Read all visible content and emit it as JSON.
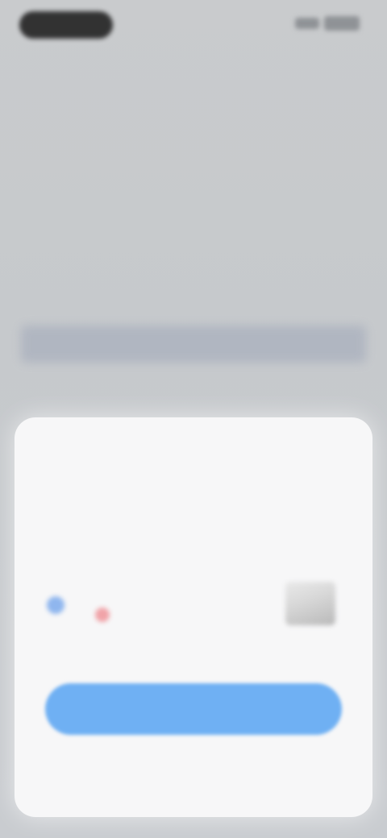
{
  "status_bar": {
    "time": "",
    "indicators": [
      "signal-icon",
      "battery-icon"
    ]
  },
  "sheet": {
    "title": "",
    "description": "",
    "option": {
      "label": "",
      "radio": "radio-icon",
      "badge": "badge-icon"
    },
    "confirm_label": "",
    "footer_link": ""
  },
  "colors": {
    "accent": "#6fb0f3",
    "background": "#c9cbcd",
    "sheet_background": "#f7f7f8"
  }
}
